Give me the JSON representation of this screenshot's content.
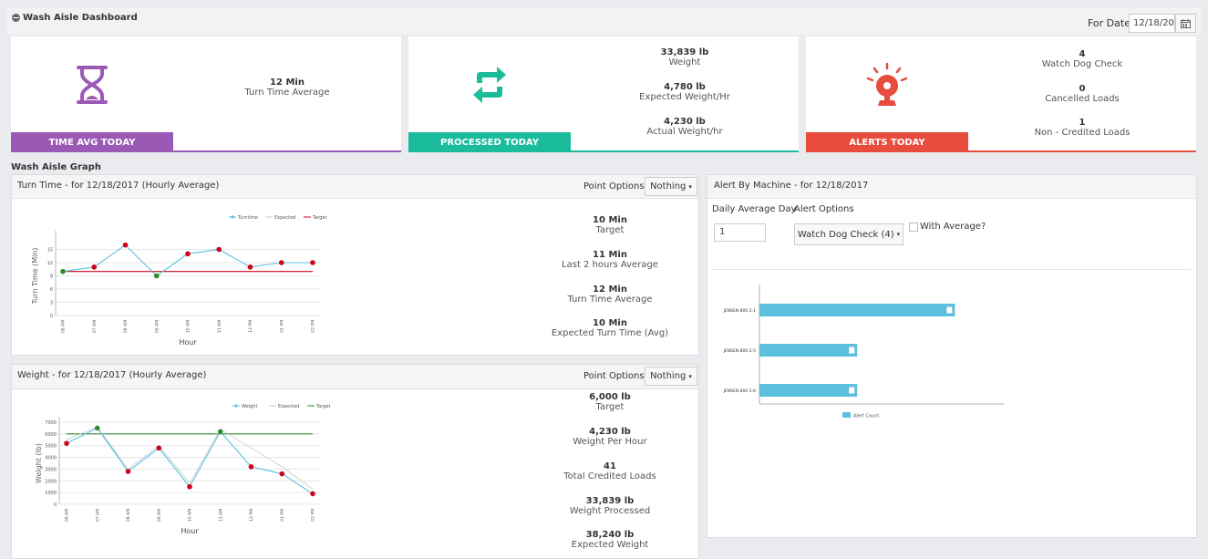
{
  "header": {
    "title": "Wash Aisle Dashboard",
    "for_date_label": "For Date",
    "date_value": "12/18/20"
  },
  "kpis": {
    "time": {
      "band": "TIME AVG TODAY",
      "color": "#9b59b6",
      "icon": "hourglass-icon",
      "value": "12 Min",
      "label": "Turn Time Average"
    },
    "processed": {
      "band": "PROCESSED TODAY",
      "color": "#1abc9c",
      "icon": "refresh-icon",
      "items": [
        {
          "value": "33,839 lb",
          "label": "Weight"
        },
        {
          "value": "4,780 lb",
          "label": "Expected Weight/Hr"
        },
        {
          "value": "4,230 lb",
          "label": "Actual Weight/hr"
        }
      ]
    },
    "alerts": {
      "band": "ALERTS TODAY",
      "color": "#e74c3c",
      "icon": "alarm-bell-icon",
      "items": [
        {
          "value": "4",
          "label": "Watch Dog Check"
        },
        {
          "value": "0",
          "label": "Cancelled Loads"
        },
        {
          "value": "1",
          "label": "Non - Credited Loads"
        }
      ]
    }
  },
  "graph_section_title": "Wash Aisle Graph",
  "turn_panel": {
    "title": "Turn Time - for 12/18/2017 (Hourly Average)",
    "point_options_label": "Point Options",
    "dropdown_value": "Nothing",
    "stats": [
      {
        "value": "10 Min",
        "label": "Target"
      },
      {
        "value": "11 Min",
        "label": "Last 2 hours Average"
      },
      {
        "value": "12 Min",
        "label": "Turn Time Average"
      },
      {
        "value": "10 Min",
        "label": "Expected Turn Time (Avg)"
      }
    ]
  },
  "weight_panel": {
    "title": "Weight - for 12/18/2017 (Hourly Average)",
    "point_options_label": "Point Options",
    "dropdown_value": "Nothing",
    "stats": [
      {
        "value": "6,000 lb",
        "label": "Target"
      },
      {
        "value": "4,230 lb",
        "label": "Weight Per Hour"
      },
      {
        "value": "41",
        "label": "Total Credited Loads"
      },
      {
        "value": "33,839 lb",
        "label": "Weight Processed"
      },
      {
        "value": "38,240 lb",
        "label": "Expected Weight"
      }
    ]
  },
  "alert_panel": {
    "title": "Alert By Machine - for 12/18/2017",
    "daily_avg_label": "Daily Average Day",
    "alert_options_label": "Alert Options",
    "daily_avg_value": "1",
    "alert_dropdown_value": "Watch Dog Check (4)",
    "with_average_label": "With Average?"
  },
  "chart_data": [
    {
      "type": "line",
      "title": "",
      "xlabel": "Hour",
      "ylabel": "Turn Time (Min)",
      "categories": [
        "06 AM",
        "07 AM",
        "08 AM",
        "09 AM",
        "10 AM",
        "11 AM",
        "12 PM",
        "01 PM",
        "02 PM"
      ],
      "ylim": [
        0,
        18
      ],
      "yticks": [
        0,
        3,
        6,
        9,
        12,
        15
      ],
      "legend": [
        "Turntime",
        "Expected",
        "Target"
      ],
      "legend_position": "top-right",
      "series": [
        {
          "name": "Turntime",
          "color": "#5bc0de",
          "values": [
            10,
            11,
            16,
            9,
            14,
            15,
            11,
            12,
            12
          ],
          "point_colors": [
            "#2e8b2e",
            "#d0021b",
            "#d0021b",
            "#2e8b2e",
            "#d0021b",
            "#d0021b",
            "#d0021b",
            "#d0021b",
            "#d0021b"
          ]
        },
        {
          "name": "Target",
          "color": "#d0021b",
          "values": [
            10,
            10,
            10,
            10,
            10,
            10,
            10,
            10,
            10
          ]
        }
      ]
    },
    {
      "type": "line",
      "title": "",
      "xlabel": "Hour",
      "ylabel": "Weight (lb)",
      "categories": [
        "06 AM",
        "07 AM",
        "08 AM",
        "09 AM",
        "10 AM",
        "11 AM",
        "12 PM",
        "01 PM",
        "02 PM"
      ],
      "ylim": [
        0,
        7000
      ],
      "yticks": [
        0,
        1000,
        2000,
        3000,
        4000,
        5000,
        6000,
        7000
      ],
      "legend": [
        "Weight",
        "Expected",
        "Target"
      ],
      "legend_position": "top-right",
      "series": [
        {
          "name": "Weight",
          "color": "#5bc0de",
          "values": [
            5200,
            6500,
            2800,
            4800,
            1500,
            6200,
            3200,
            2600,
            900
          ],
          "point_colors": [
            "#d0021b",
            "#2e8b2e",
            "#d0021b",
            "#d0021b",
            "#d0021b",
            "#2e8b2e",
            "#d0021b",
            "#d0021b",
            "#d0021b"
          ]
        },
        {
          "name": "Expected",
          "color": "#c8c8c8",
          "values": [
            5500,
            6600,
            3000,
            5000,
            1800,
            6400,
            4800,
            3200,
            1300
          ]
        },
        {
          "name": "Target",
          "color": "#2e8b2e",
          "values": [
            6000,
            6000,
            6000,
            6000,
            6000,
            6000,
            6000,
            6000,
            6000
          ]
        }
      ]
    },
    {
      "type": "bar",
      "orientation": "horizontal",
      "title": "",
      "categories": [
        "JENSEN 800 2-1",
        "JENSEN 800 2-5",
        "JENSEN 800 2-6"
      ],
      "xlim": [
        0,
        5
      ],
      "series": [
        {
          "name": "Alert Count",
          "color": "#5bc0de",
          "values": [
            4,
            2,
            2
          ]
        }
      ],
      "legend_position": "bottom"
    }
  ]
}
